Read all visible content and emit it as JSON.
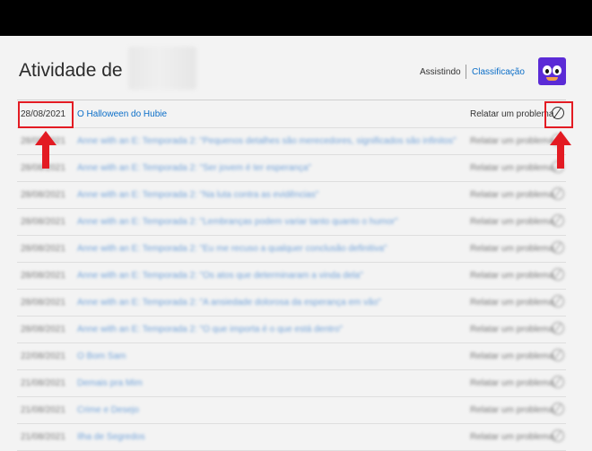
{
  "header": {
    "title": "Atividade de",
    "watching_label": "Assistindo",
    "rating_label": "Classificação"
  },
  "rows": [
    {
      "date": "28/08/2021",
      "title": "O Halloween do Hubie",
      "report": "Relatar um problema"
    },
    {
      "date": "28/08/2021",
      "title": "Anne with an E: Temporada 2: \"Pequenos detalhes são merecedores, significados são infinitos\"",
      "report": "Relatar um problema"
    },
    {
      "date": "28/08/2021",
      "title": "Anne with an E: Temporada 2: \"Ser jovem é ter esperança\"",
      "report": "Relatar um problema"
    },
    {
      "date": "28/08/2021",
      "title": "Anne with an E: Temporada 2: \"Na luta contra as evidências\"",
      "report": "Relatar um problema"
    },
    {
      "date": "28/08/2021",
      "title": "Anne with an E: Temporada 2: \"Lembranças podem variar tanto quanto o humor\"",
      "report": "Relatar um problema"
    },
    {
      "date": "28/08/2021",
      "title": "Anne with an E: Temporada 2: \"Eu me recuso a qualquer conclusão definitiva\"",
      "report": "Relatar um problema"
    },
    {
      "date": "28/08/2021",
      "title": "Anne with an E: Temporada 2: \"Os atos que determinaram a vinda dela\"",
      "report": "Relatar um problema"
    },
    {
      "date": "28/08/2021",
      "title": "Anne with an E: Temporada 2: \"A ansiedade dolorosa da esperança em vão\"",
      "report": "Relatar um problema"
    },
    {
      "date": "28/08/2021",
      "title": "Anne with an E: Temporada 2: \"O que importa é o que está dentro\"",
      "report": "Relatar um problema"
    },
    {
      "date": "22/08/2021",
      "title": "O Bom Sam",
      "report": "Relatar um problema"
    },
    {
      "date": "21/08/2021",
      "title": "Demais pra Mim",
      "report": "Relatar um problema"
    },
    {
      "date": "21/08/2021",
      "title": "Crime e Desejo",
      "report": "Relatar um problema"
    },
    {
      "date": "21/08/2021",
      "title": "Ilha de Segredos",
      "report": "Relatar um problema"
    }
  ]
}
